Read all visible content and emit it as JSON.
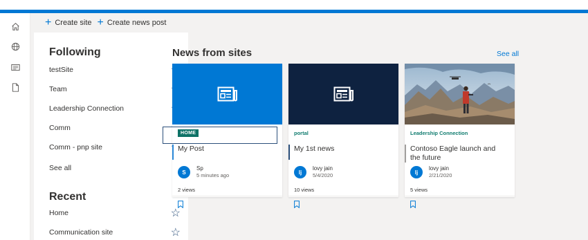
{
  "brand": {
    "accent": "#0078d4",
    "teal": "#0e7266",
    "navy": "#0e2240"
  },
  "rail": {
    "icons": [
      "home-icon",
      "globe-icon",
      "news-icon",
      "document-icon"
    ]
  },
  "commandbar": {
    "create_site": "Create site",
    "create_news_post": "Create news post"
  },
  "following": {
    "title": "Following",
    "items": [
      {
        "label": "testSite"
      },
      {
        "label": "Team"
      },
      {
        "label": "Leadership Connection"
      },
      {
        "label": "Comm"
      },
      {
        "label": "Comm - pnp site"
      }
    ],
    "see_all": "See all"
  },
  "recent": {
    "title": "Recent",
    "items": [
      {
        "label": "Home"
      },
      {
        "label": "Communication site"
      }
    ]
  },
  "news": {
    "title": "News from sites",
    "see_all": "See all",
    "cards": [
      {
        "site": "HOME",
        "title": "My Post",
        "author_initials": "S",
        "author": "Sp",
        "date": "5 minutes ago",
        "views": "2 views"
      },
      {
        "site": "portal",
        "title": "My 1st news",
        "author_initials": "lj",
        "author": "lovy jain",
        "date": "5/4/2020",
        "views": "10 views"
      },
      {
        "site": "Leadership Connection",
        "title": "Contoso Eagle launch and the future",
        "author_initials": "lj",
        "author": "lovy jain",
        "date": "2/21/2020",
        "views": "5 views"
      }
    ]
  }
}
